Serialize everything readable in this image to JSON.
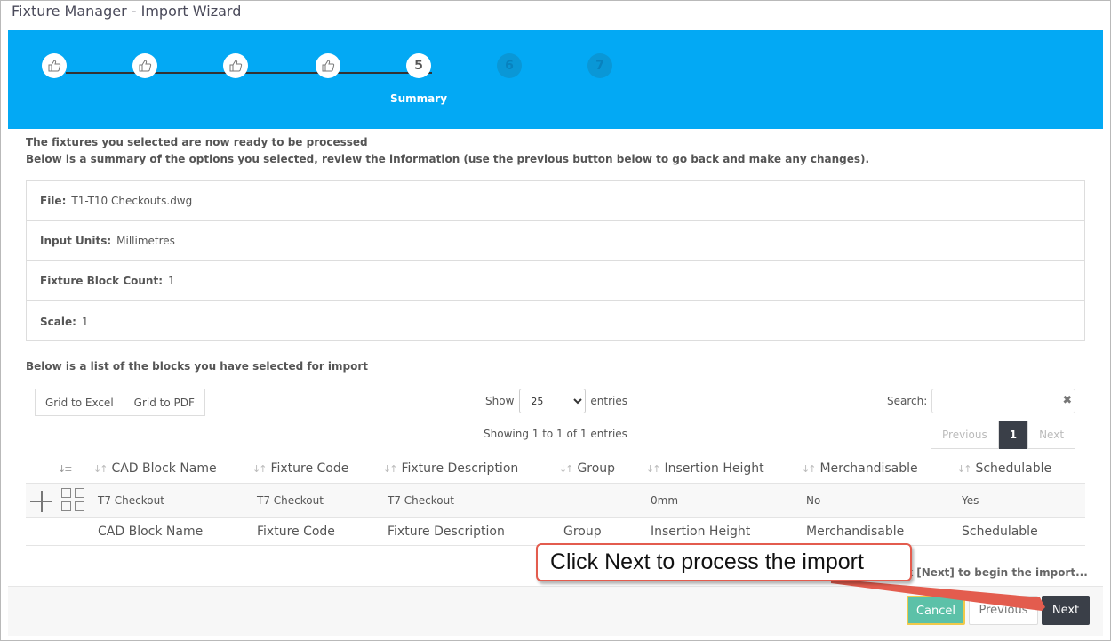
{
  "window": {
    "title": "Fixture Manager - Import Wizard"
  },
  "wizard": {
    "steps": [
      {
        "label": "",
        "state": "done",
        "icon": "thumbs-up-icon"
      },
      {
        "label": "",
        "state": "done",
        "icon": "thumbs-up-icon"
      },
      {
        "label": "",
        "state": "done",
        "icon": "thumbs-up-icon"
      },
      {
        "label": "",
        "state": "done",
        "icon": "thumbs-up-icon"
      },
      {
        "number": "5",
        "label": "Summary",
        "state": "active"
      },
      {
        "number": "6",
        "state": "todo"
      },
      {
        "number": "7",
        "state": "todo"
      }
    ],
    "accent_color": "#03a9f4"
  },
  "intro": {
    "line1": "The fixtures you selected are now ready to be processed",
    "line2": "Below is a summary of the options you selected, review the information (use the previous button below to go back and make any changes)."
  },
  "summary": {
    "file_label": "File:",
    "file_value": "T1-T10 Checkouts.dwg",
    "units_label": "Input Units:",
    "units_value": "Millimetres",
    "count_label": "Fixture Block Count:",
    "count_value": "1",
    "scale_label": "Scale:",
    "scale_value": "1"
  },
  "blocks": {
    "title": "Below is a list of the blocks you have selected for import",
    "export_excel": "Grid to Excel",
    "export_pdf": "Grid to PDF",
    "show_label": "Show",
    "page_size": "25",
    "entries_label": "entries",
    "search_label": "Search:",
    "search_value": "",
    "showing": "Showing 1 to 1 of 1 entries",
    "pager": {
      "previous": "Previous",
      "current": "1",
      "next": "Next"
    },
    "columns": [
      "CAD Block Name",
      "Fixture Code",
      "Fixture Description",
      "Group",
      "Insertion Height",
      "Merchandisable",
      "Schedulable"
    ],
    "rows": [
      [
        "T7 Checkout",
        "T7 Checkout",
        "T7 Checkout",
        "",
        "0mm",
        "No",
        "Yes"
      ]
    ]
  },
  "hint": "ck [Next] to begin the import...",
  "footer": {
    "cancel": "Cancel",
    "previous": "Previous",
    "next": "Next"
  },
  "callout": "Click Next to process the import"
}
